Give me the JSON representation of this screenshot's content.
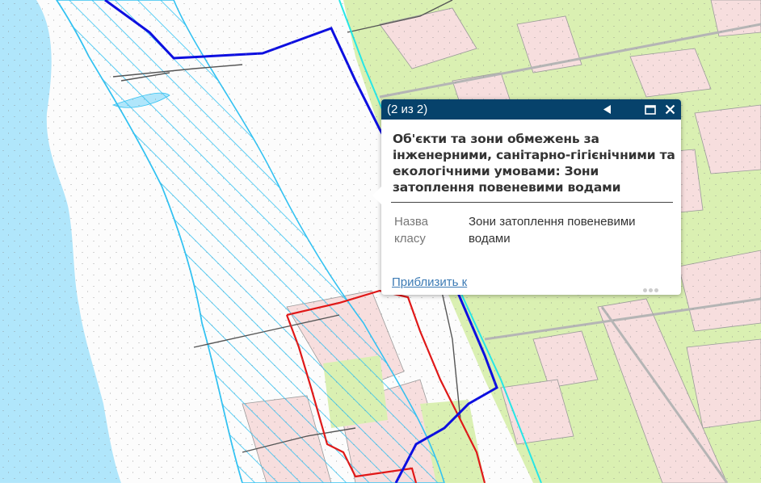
{
  "map": {
    "colors": {
      "water": "#b0e6fb",
      "vegetation": "#daf0b2",
      "built_zone": "#f7dede",
      "block_fill": "#fafafa",
      "hatch_zone": "#33c2f2",
      "boundary_blue": "#0d0fe0",
      "boundary_red": "#e01818",
      "cyan_line": "#27e6e6"
    },
    "layer_name": "Зони затоплення повеневими водами"
  },
  "popup": {
    "counter": "(2 из 2)",
    "prev_icon": "left-triangle-icon",
    "maximize_icon": "maximize-icon",
    "close_icon": "close-icon",
    "title": "Об'єкти та зони обмежень за інженерними, санітарно-гігієнічними та екологічними умовами: Зони затоплення повеневими водами",
    "field_label": "Назва класу",
    "field_value": "Зони затоплення повеневими водами",
    "zoom_link": "Приблизить к",
    "more_icon": "ellipsis-icon"
  }
}
